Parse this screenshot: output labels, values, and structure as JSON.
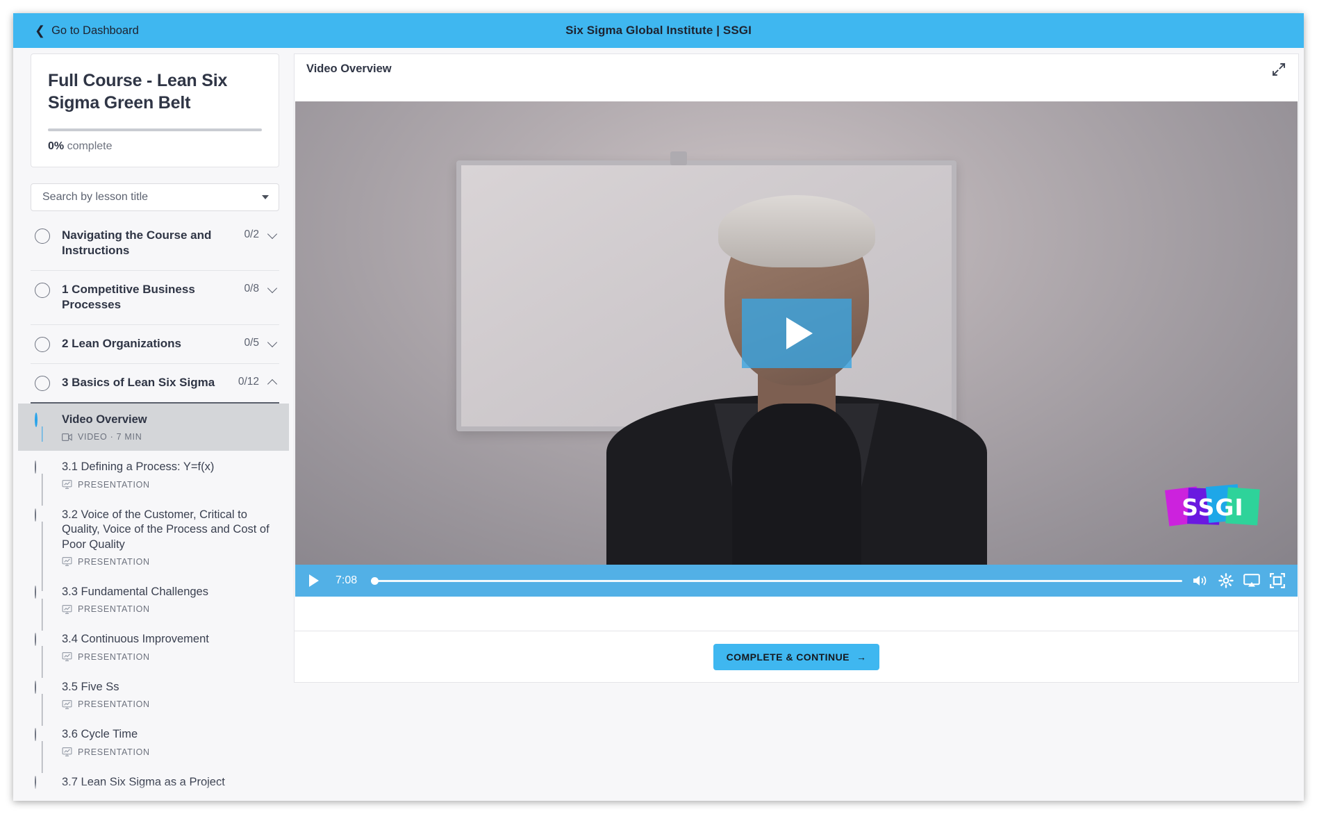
{
  "topbar": {
    "back_label": "Go to Dashboard",
    "back_icon": "chevron-left-icon",
    "title": "Six Sigma Global Institute | SSGI",
    "background": "#3fb7f0"
  },
  "sidebar": {
    "course_title": "Full Course - Lean Six Sigma Green Belt",
    "progress_percent": "0%",
    "progress_value": 0,
    "progress_suffix": "complete",
    "search_placeholder": "Search by lesson title",
    "sections": [
      {
        "title": "Navigating the Course and Instructions",
        "count": "0/2",
        "expanded": false
      },
      {
        "title": "1 Competitive Business Processes",
        "count": "0/8",
        "expanded": false
      },
      {
        "title": "2 Lean Organizations",
        "count": "0/5",
        "expanded": false
      },
      {
        "title": "3 Basics of Lean Six Sigma",
        "count": "0/12",
        "expanded": true
      }
    ],
    "lessons": [
      {
        "title": "Video Overview",
        "meta": "VIDEO · 7 MIN",
        "type": "video",
        "active": true
      },
      {
        "title": "3.1 Defining a Process: Y=f(x)",
        "meta": "PRESENTATION",
        "type": "presentation",
        "active": false
      },
      {
        "title": "3.2 Voice of the Customer, Critical to Quality, Voice of the Process and Cost of Poor Quality",
        "meta": "PRESENTATION",
        "type": "presentation",
        "active": false
      },
      {
        "title": "3.3 Fundamental Challenges",
        "meta": "PRESENTATION",
        "type": "presentation",
        "active": false
      },
      {
        "title": "3.4 Continuous Improvement",
        "meta": "PRESENTATION",
        "type": "presentation",
        "active": false
      },
      {
        "title": "3.5 Five Ss",
        "meta": "PRESENTATION",
        "type": "presentation",
        "active": false
      },
      {
        "title": "3.6 Cycle Time",
        "meta": "PRESENTATION",
        "type": "presentation",
        "active": false
      },
      {
        "title": "3.7 Lean Six Sigma as a Project",
        "meta": "",
        "type": "presentation",
        "active": false
      }
    ]
  },
  "main": {
    "lesson_title": "Video Overview",
    "expand_icon": "expand-diagonal-icon",
    "player": {
      "play_icon": "play-icon",
      "overlay_play_icon": "play-overlay-icon",
      "time": "7:08",
      "progress_percent": 0,
      "volume_icon": "volume-icon",
      "settings_icon": "gear-icon",
      "cast_icon": "airplay-icon",
      "fullscreen_icon": "fullscreen-icon",
      "accent": "#3aa5e2"
    },
    "watermark": {
      "text": "SSGI",
      "colors": [
        "#cc22dd",
        "#6a19e0",
        "#1ea7e8",
        "#2ed39a"
      ]
    },
    "cta_label": "COMPLETE & CONTINUE",
    "cta_arrow": "→"
  }
}
